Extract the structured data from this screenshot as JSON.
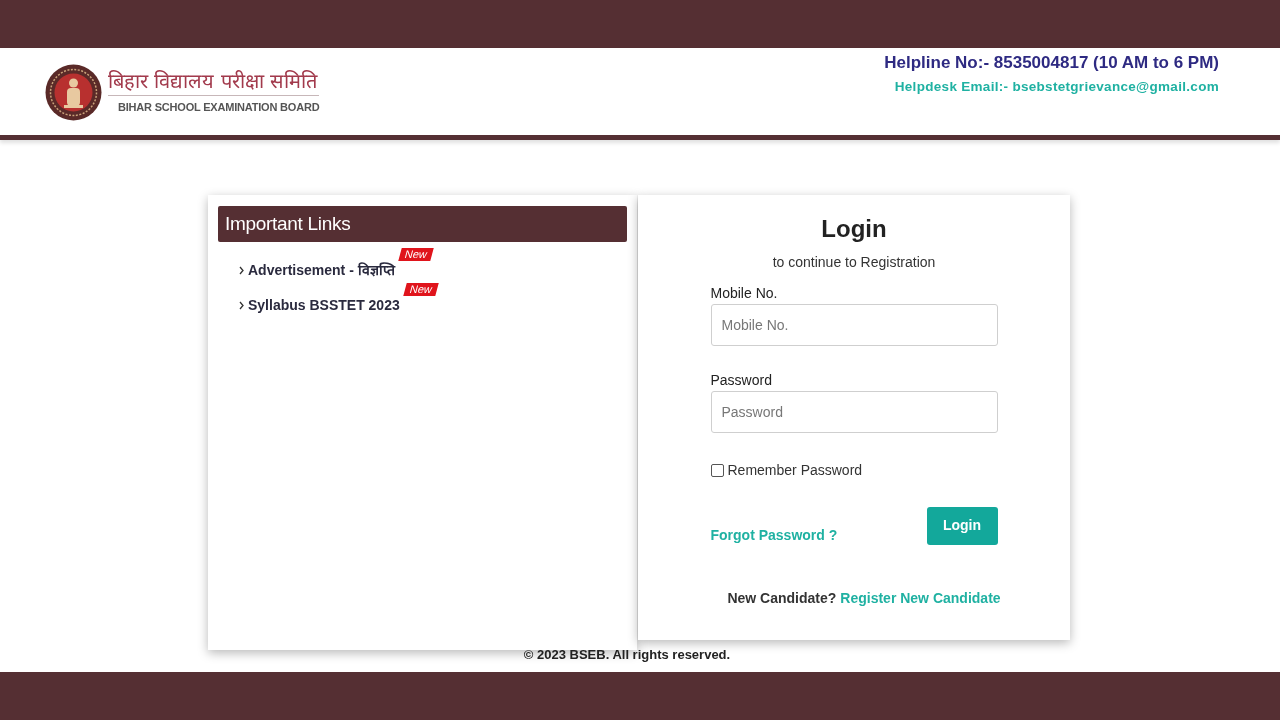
{
  "header": {
    "logo": {
      "title_hindi": "बिहार विद्यालय परीक्षा समिति",
      "title_english": "BIHAR SCHOOL EXAMINATION BOARD"
    },
    "helpline": "Helpline No:- 8535004817 (10 AM to 6 PM)",
    "email": "Helpdesk Email:- bsebstetgrievance@gmail.com"
  },
  "important_links": {
    "title": "Important Links",
    "items": [
      {
        "label": "Advertisement - विज्ञप्ति",
        "badge": "New"
      },
      {
        "label": "Syllabus BSSTET 2023",
        "badge": "New"
      }
    ]
  },
  "login": {
    "title": "Login",
    "subtitle": "to continue to Registration",
    "fields": [
      {
        "label": "Mobile No.",
        "placeholder": "Mobile No."
      },
      {
        "label": "Password",
        "placeholder": "Password"
      }
    ],
    "remember": {
      "label": "Remember Password",
      "checked": false
    },
    "forgot_link": "Forgot Password ?",
    "submit": "Login",
    "register_prompt": "New Candidate?",
    "register_link": "Register New Candidate"
  },
  "footer": {
    "copyright": "© 2023 BSEB. All rights reserved."
  }
}
